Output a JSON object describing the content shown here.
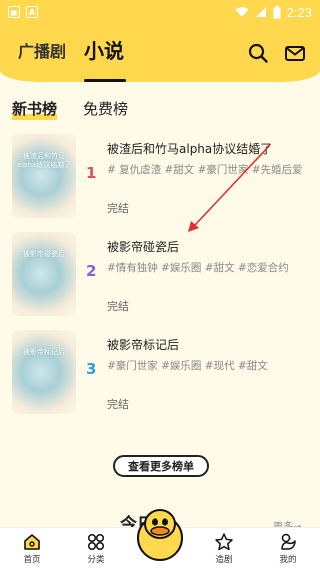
{
  "statusbar": {
    "time": "2:23",
    "left_icon_1": "A"
  },
  "header": {
    "tabs": [
      "广播剧",
      "小说"
    ],
    "active_tab": "小说"
  },
  "sub_tabs": [
    "新书榜",
    "免费榜"
  ],
  "books": [
    {
      "rank": "1",
      "title": "被渣后和竹马alpha协议结婚了",
      "tags": "# 复仇虐渣 #甜文 #豪门世家 #先婚后爱",
      "status": "完结",
      "cover_text": "被渣后和竹马alpha协议结婚了",
      "rank_color": "#e05252"
    },
    {
      "rank": "2",
      "title": "被影帝碰瓷后",
      "tags": "#情有独钟 #娱乐圈 #甜文 #恋爱合约",
      "status": "完结",
      "cover_text": "被影帝碰瓷后",
      "rank_color": "#8a5cd6"
    },
    {
      "rank": "3",
      "title": "被影帝标记后",
      "tags": "#豪门世家 #娱乐圈 #现代 #甜文",
      "status": "完结",
      "cover_text": "被影帝标记后",
      "rank_color": "#2aa0d8"
    }
  ],
  "more_button": "查看更多榜单",
  "next_section": {
    "title": "今日新",
    "more": "更多→"
  },
  "bottom_nav": {
    "home": "首页",
    "category": "分类",
    "make": "造剧",
    "me": "我的"
  },
  "colors": {
    "accent": "#ffd84d",
    "annotation": "#e03030"
  }
}
